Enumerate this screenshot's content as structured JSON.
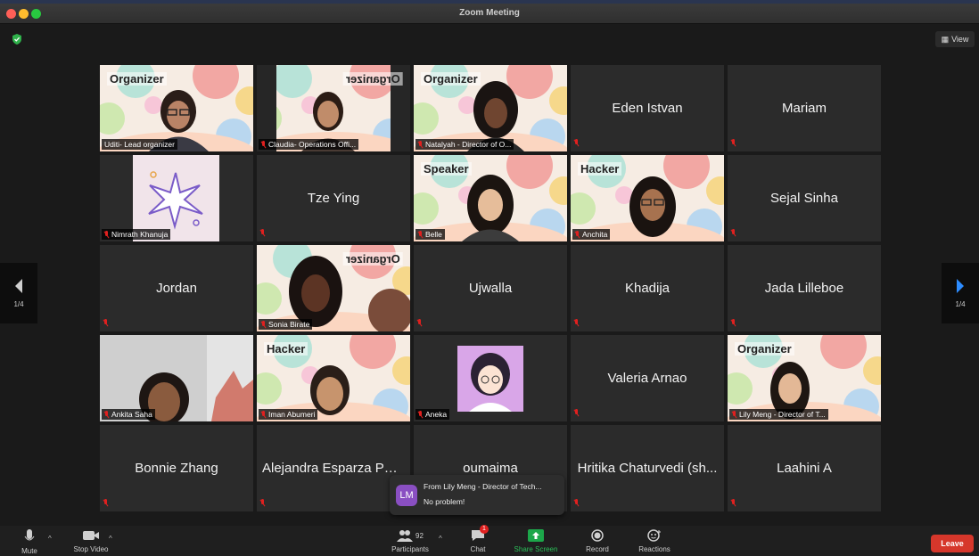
{
  "window": {
    "title": "Zoom Meeting"
  },
  "top_controls": {
    "view_label": "View"
  },
  "navigation": {
    "prev_page": "1/4",
    "next_page": "1/4"
  },
  "tiles": {
    "udit": {
      "badge": "Organizer",
      "label": "Uditi- Lead organizer"
    },
    "claudia": {
      "badge": "Organizer",
      "label": "Claudia- Operations Offi..."
    },
    "natalyah": {
      "badge": "Organizer",
      "label": "Natalyah - Director of O..."
    },
    "eden": {
      "name": "Eden Istvan"
    },
    "mariam": {
      "name": "Mariam"
    },
    "nimrath": {
      "label": "Nimrath Khanuja"
    },
    "tze": {
      "name": "Tze Ying"
    },
    "belle": {
      "badge": "Speaker",
      "label": "Belle"
    },
    "anchita": {
      "badge": "Hacker",
      "label": "Anchita"
    },
    "sejal": {
      "name": "Sejal Sinha"
    },
    "jordan": {
      "name": "Jordan"
    },
    "sonia": {
      "badge": "Organizer",
      "label": "Sonia Birate"
    },
    "ujwalla": {
      "name": "Ujwalla"
    },
    "khadija": {
      "name": "Khadija"
    },
    "jada": {
      "name": "Jada Lilleboe"
    },
    "ankita": {
      "label": "Ankita Saha"
    },
    "iman": {
      "badge": "Hacker",
      "label": "Iman Abumeri"
    },
    "aneka": {
      "label": "Aneka"
    },
    "valeria": {
      "name": "Valeria Arnao"
    },
    "lily": {
      "badge": "Organizer",
      "label": "Lily Meng - Director of T..."
    },
    "bonnie": {
      "name": "Bonnie Zhang"
    },
    "alejandra": {
      "name": "Alejandra Esparza Pel..."
    },
    "oumaima": {
      "name": "oumaima"
    },
    "hritika": {
      "name": "Hritika Chaturvedi (sh..."
    },
    "laahini": {
      "name": "Laahini A"
    }
  },
  "chat_toast": {
    "initials": "LM",
    "from": "From Lily Meng - Director of Tech...",
    "message": "No problem!"
  },
  "toolbar": {
    "mute": "Mute",
    "stop_video": "Stop Video",
    "participants": "Participants",
    "participants_count": "92",
    "chat": "Chat",
    "chat_badge": "1",
    "share_screen": "Share Screen",
    "record": "Record",
    "reactions": "Reactions",
    "leave": "Leave"
  },
  "colors": {
    "accent": "#2d8cff",
    "share_green": "#1ca74a",
    "leave_red": "#d6372b",
    "avatar_purple": "#8a4fc2"
  }
}
